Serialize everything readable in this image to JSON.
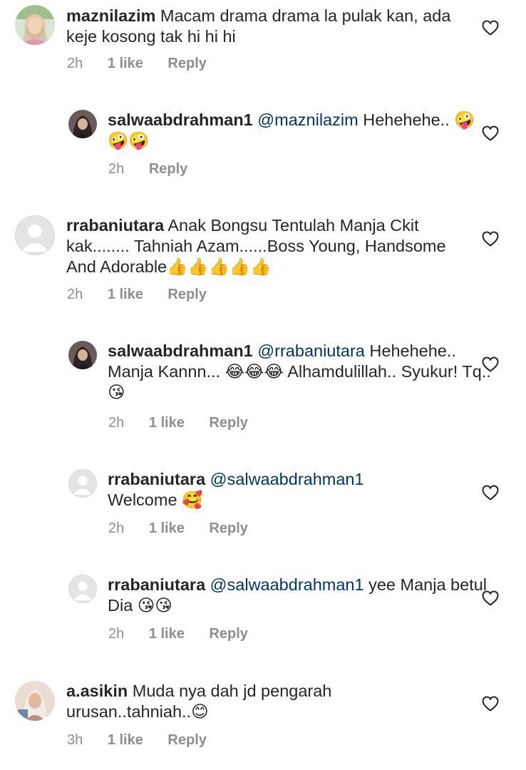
{
  "comments": [
    {
      "username": "maznilazim",
      "mention": "",
      "text": "Macam drama drama la pulak kan, ada keje kosong tak hi hi hi",
      "time": "2h",
      "likes": "1 like",
      "reply": "Reply"
    },
    {
      "username": "salwaabdrahman1",
      "mention": "@maznilazim",
      "text": "Hehehehe.. 🤪🤪🤪",
      "time": "2h",
      "likes": "",
      "reply": "Reply"
    },
    {
      "username": "rrabaniutara",
      "mention": "",
      "text": "Anak Bongsu Tentulah Manja Ckit kak........ Tahniah Azam......Boss Young, Handsome And Adorable👍👍👍👍👍",
      "time": "2h",
      "likes": "1 like",
      "reply": "Reply"
    },
    {
      "username": "salwaabdrahman1",
      "mention": "@rrabaniutara",
      "text": "Hehehehe.. Manja Kannn... 😂😂😂 Alhamdulillah.. Syukur! Tq.. 😘",
      "time": "2h",
      "likes": "1 like",
      "reply": "Reply"
    },
    {
      "username": "rrabaniutara",
      "mention": "@salwaabdrahman1",
      "text": "Welcome 🥰",
      "time": "2h",
      "likes": "1 like",
      "reply": "Reply"
    },
    {
      "username": "rrabaniutara",
      "mention": "@salwaabdrahman1",
      "text": "yee Manja betul Dia 😘😘",
      "time": "2h",
      "likes": "1 like",
      "reply": "Reply"
    },
    {
      "username": "a.asikin",
      "mention": "",
      "text": "Muda nya dah jd pengarah urusan..tahniah..😊",
      "time": "3h",
      "likes": "1 like",
      "reply": "Reply"
    }
  ],
  "icons": {
    "like": "heart-outline-icon",
    "default_avatar": "default-avatar-icon"
  },
  "colors": {
    "text": "#262626",
    "meta": "#8e8e8e",
    "mention": "#003569"
  }
}
